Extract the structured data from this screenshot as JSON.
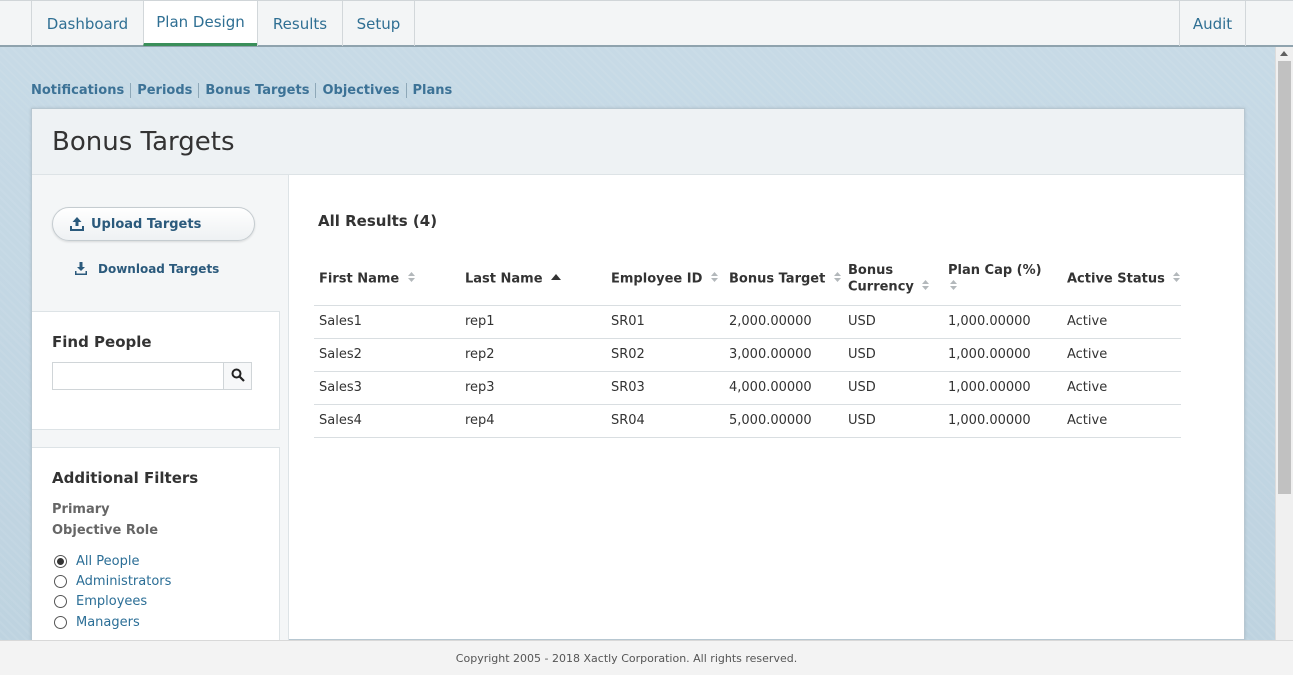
{
  "topnav": {
    "tabs": [
      {
        "label": "Dashboard",
        "active": false
      },
      {
        "label": "Plan Design",
        "active": true
      },
      {
        "label": "Results",
        "active": false
      },
      {
        "label": "Setup",
        "active": false
      }
    ],
    "audit_label": "Audit"
  },
  "subnav": {
    "items": [
      "Notifications",
      "Periods",
      "Bonus Targets",
      "Objectives",
      "Plans"
    ]
  },
  "page": {
    "title": "Bonus Targets"
  },
  "sidebar": {
    "upload_label": "Upload Targets",
    "upload_icon": "upload-icon",
    "download_label": "Download Targets",
    "download_icon": "download-icon",
    "find_title": "Find People",
    "search_value": "",
    "search_placeholder": "",
    "search_icon": "search-icon",
    "filters_title": "Additional Filters",
    "filter_label_1": "Primary",
    "filter_label_2": "Objective Role",
    "roles": [
      {
        "label": "All People",
        "checked": true
      },
      {
        "label": "Administrators",
        "checked": false
      },
      {
        "label": "Employees",
        "checked": false
      },
      {
        "label": "Managers",
        "checked": false
      }
    ]
  },
  "results": {
    "title": "All Results (4)",
    "columns": [
      {
        "line1": "First Name",
        "line2": "",
        "sort": "none"
      },
      {
        "line1": "Last Name",
        "line2": "",
        "sort": "asc"
      },
      {
        "line1": "Employee ID",
        "line2": "",
        "sort": "none"
      },
      {
        "line1": "Bonus Target",
        "line2": "",
        "sort": "none"
      },
      {
        "line1": "Bonus",
        "line2": "Currency",
        "sort": "none"
      },
      {
        "line1": "Plan Cap (%)",
        "line2": "",
        "sort": "none"
      },
      {
        "line1": "Active Status",
        "line2": "",
        "sort": "none"
      }
    ],
    "rows": [
      [
        "Sales1",
        "rep1",
        "SR01",
        "2,000.00000",
        "USD",
        "1,000.00000",
        "Active"
      ],
      [
        "Sales2",
        "rep2",
        "SR02",
        "3,000.00000",
        "USD",
        "1,000.00000",
        "Active"
      ],
      [
        "Sales3",
        "rep3",
        "SR03",
        "4,000.00000",
        "USD",
        "1,000.00000",
        "Active"
      ],
      [
        "Sales4",
        "rep4",
        "SR04",
        "5,000.00000",
        "USD",
        "1,000.00000",
        "Active"
      ]
    ]
  },
  "footer": {
    "copyright": "Copyright 2005 - 2018 Xactly Corporation. All rights reserved."
  },
  "colors": {
    "link": "#2f6f93",
    "active_tab_underline": "#3a8f5a",
    "background": "#c5d8e4"
  }
}
